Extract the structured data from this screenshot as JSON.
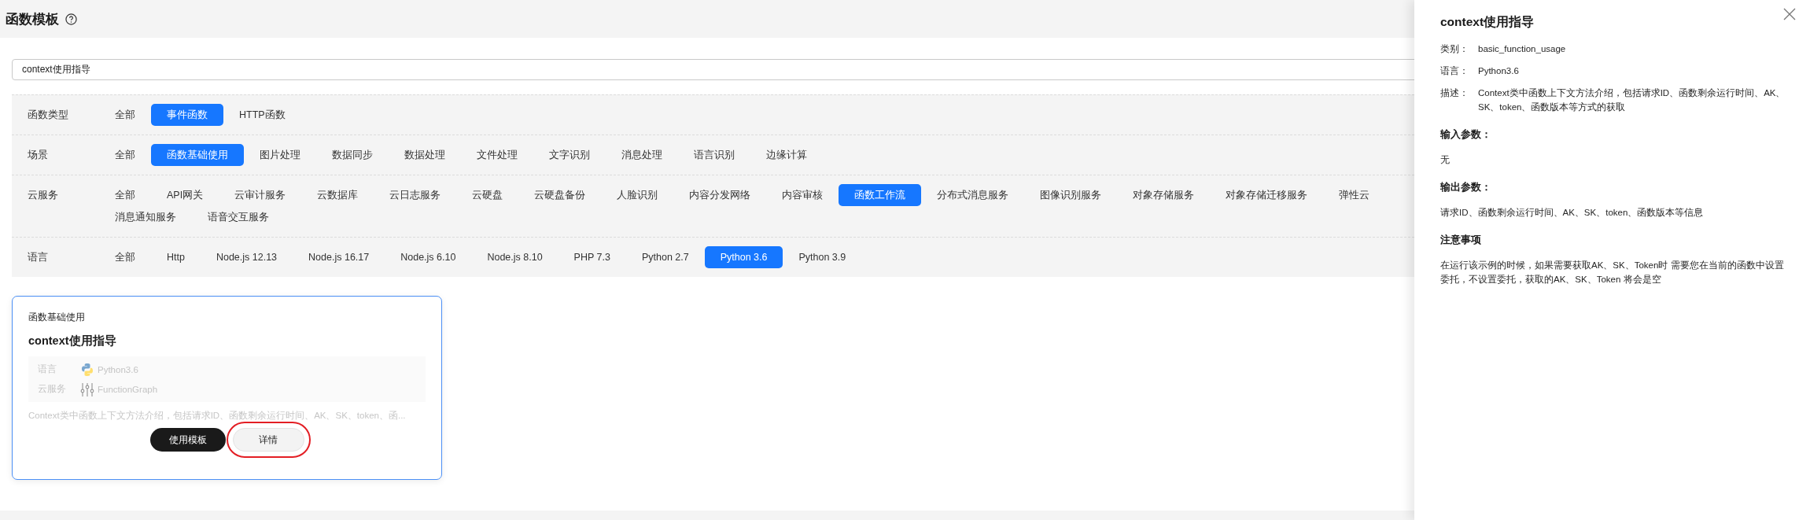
{
  "page": {
    "title": "函数模板"
  },
  "search": {
    "value": "context使用指导"
  },
  "filters": [
    {
      "label": "函数类型",
      "option_lines": [
        [
          {
            "label": "全部",
            "selected": false
          },
          {
            "label": "事件函数",
            "selected": true
          },
          {
            "label": "HTTP函数",
            "selected": false
          }
        ]
      ]
    },
    {
      "label": "场景",
      "option_lines": [
        [
          {
            "label": "全部",
            "selected": false
          },
          {
            "label": "函数基础使用",
            "selected": true
          },
          {
            "label": "图片处理",
            "selected": false
          },
          {
            "label": "数据同步",
            "selected": false
          },
          {
            "label": "数据处理",
            "selected": false
          },
          {
            "label": "文件处理",
            "selected": false
          },
          {
            "label": "文字识别",
            "selected": false
          },
          {
            "label": "消息处理",
            "selected": false
          },
          {
            "label": "语言识别",
            "selected": false
          },
          {
            "label": "边缘计算",
            "selected": false
          }
        ]
      ]
    },
    {
      "label": "云服务",
      "option_lines": [
        [
          {
            "label": "全部",
            "selected": false
          },
          {
            "label": "API网关",
            "selected": false
          },
          {
            "label": "云审计服务",
            "selected": false
          },
          {
            "label": "云数据库",
            "selected": false
          },
          {
            "label": "云日志服务",
            "selected": false
          },
          {
            "label": "云硬盘",
            "selected": false
          },
          {
            "label": "云硬盘备份",
            "selected": false
          },
          {
            "label": "人脸识别",
            "selected": false
          },
          {
            "label": "内容分发网络",
            "selected": false
          },
          {
            "label": "内容审核",
            "selected": false
          },
          {
            "label": "函数工作流",
            "selected": true
          },
          {
            "label": "分布式消息服务",
            "selected": false
          },
          {
            "label": "图像识别服务",
            "selected": false
          },
          {
            "label": "对象存储服务",
            "selected": false
          },
          {
            "label": "对象存储迁移服务",
            "selected": false
          },
          {
            "label": "弹性云",
            "selected": false
          }
        ],
        [
          {
            "label": "消息通知服务",
            "selected": false
          },
          {
            "label": "语音交互服务",
            "selected": false
          }
        ]
      ]
    },
    {
      "label": "语言",
      "option_lines": [
        [
          {
            "label": "全部",
            "selected": false
          },
          {
            "label": "Http",
            "selected": false
          },
          {
            "label": "Node.js 12.13",
            "selected": false
          },
          {
            "label": "Node.js 16.17",
            "selected": false
          },
          {
            "label": "Node.js 6.10",
            "selected": false
          },
          {
            "label": "Node.js 8.10",
            "selected": false
          },
          {
            "label": "PHP 7.3",
            "selected": false
          },
          {
            "label": "Python 2.7",
            "selected": false
          },
          {
            "label": "Python 3.6",
            "selected": true
          },
          {
            "label": "Python 3.9",
            "selected": false
          }
        ]
      ]
    }
  ],
  "template_card": {
    "category": "函数基础使用",
    "title": "context使用指导",
    "details": [
      {
        "label": "语言",
        "value": "Python3.6",
        "kind": "python"
      },
      {
        "label": "云服务",
        "value": "FunctionGraph",
        "kind": "functiongraph"
      }
    ],
    "description": "Context类中函数上下文方法介绍，包括请求ID、函数剩余运行时间、AK、SK、token、函...",
    "buttons": [
      {
        "label": "使用模板",
        "kind": "primary",
        "highlighted": false
      },
      {
        "label": "详情",
        "kind": "secondary",
        "highlighted": true
      }
    ]
  },
  "drawer": {
    "title": "context使用指导",
    "fields": [
      {
        "label": "类别：",
        "value": "basic_function_usage"
      },
      {
        "label": "语言：",
        "value": "Python3.6"
      },
      {
        "label": "描述：",
        "value": "Context类中函数上下文方法介绍，包括请求ID、函数剩余运行时间、AK、SK、token、函数版本等方式的获取"
      }
    ],
    "sections": [
      {
        "heading": "输入参数：",
        "text": "无"
      },
      {
        "heading": "输出参数：",
        "text": "请求ID、函数剩余运行时间、AK、SK、token、函数版本等信息"
      },
      {
        "heading": "注意事项",
        "text": "在运行该示例的时候，如果需要获取AK、SK、Token时 需要您在当前的函数中设置委托，不设置委托，获取的AK、SK、Token 将会是空"
      }
    ]
  }
}
